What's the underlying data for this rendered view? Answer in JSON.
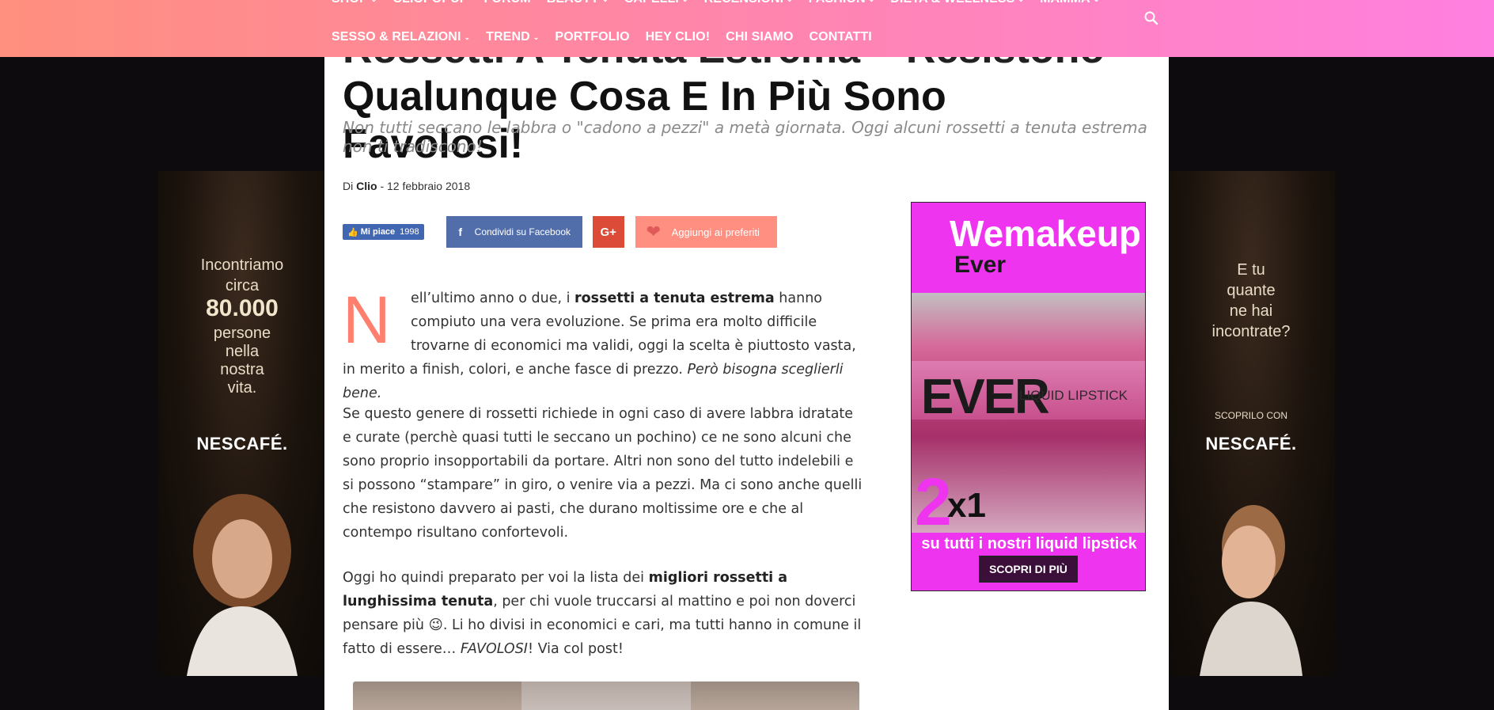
{
  "nav": {
    "row1": [
      {
        "label": "SHOP",
        "dropdown": true
      },
      {
        "label": "CLIOPOPUP",
        "dropdown": false
      },
      {
        "label": "FORUM",
        "dropdown": false
      },
      {
        "label": "BEAUTY",
        "dropdown": true
      },
      {
        "label": "CAPELLI",
        "dropdown": true
      },
      {
        "label": "RECENSIONI",
        "dropdown": true
      },
      {
        "label": "FASHION",
        "dropdown": true
      },
      {
        "label": "DIETA & WELLNESS",
        "dropdown": true
      },
      {
        "label": "MAMMA",
        "dropdown": true
      }
    ],
    "row2": [
      {
        "label": "SESSO & RELAZIONI",
        "dropdown": true
      },
      {
        "label": "TREND",
        "dropdown": true
      },
      {
        "label": "PORTFOLIO",
        "dropdown": false
      },
      {
        "label": "HEY CLIO!",
        "dropdown": false
      },
      {
        "label": "CHI SIAMO",
        "dropdown": false
      },
      {
        "label": "CONTATTI",
        "dropdown": false
      }
    ],
    "chevron": "⌄"
  },
  "article": {
    "title_line1": "Rossetti A Tenuta Estrema – Resistono A",
    "title_line2": "Qualunque Cosa E In Più Sono Favolosi!",
    "subtitle": "Non tutti seccano le labbra o \"cadono a pezzi\" a metà giornata. Oggi alcuni rossetti a tenuta estrema non ti tradiscono!",
    "by_prefix": "Di",
    "author": "Clio",
    "date": "- 12 febbraio 2018",
    "dropcap": "N",
    "p1_a": "ell’ultimo anno o due, i ",
    "p1_b": "rossetti a tenuta estrema",
    "p1_c": " hanno compiuto una vera evoluzione. Se prima era molto difficile trovarne di economici ma validi, oggi la scelta è piuttosto vasta, in merito a finish, colori, e anche fasce di prezzo. ",
    "p1_d": "Però bisogna sceglierli bene.",
    "p2": "Se questo genere di rossetti richiede in ogni caso di avere labbra idratate e curate (perchè quasi tutti le seccano un pochino) ce ne sono alcuni che sono proprio insopportabili da portare. Altri non sono del tutto indelebili e si possono “stampare” in giro, o venire via a pezzi. Ma ci sono anche quelli che resistono davvero ai pasti, che durano moltissime ore e che al contempo risultano confortevoli.",
    "p3_a": "Oggi ho quindi preparato per voi la lista dei ",
    "p3_b": "migliori rossetti a lunghissima tenuta",
    "p3_c": ", per chi vuole truccarsi al mattino e poi non doverci pensare più 😉. Li ho divisi in economici e cari, ma tutti hanno in comune il fatto di essere… ",
    "p3_d": "FAVOLOSI",
    "p3_e": "! Via col post!"
  },
  "share": {
    "like_label": "Mi piace",
    "like_count": "1998",
    "facebook": "Condividi su Facebook",
    "gplus": "G+",
    "favorites": "Aggiungi ai preferiti"
  },
  "ads": {
    "left": {
      "line1": "Incontriamo",
      "line2": "circa",
      "big": "80.000",
      "line3": "persone",
      "line4": "nella",
      "line5": "nostra",
      "line6": "vita.",
      "brand": "NESCAFÉ."
    },
    "right": {
      "line1": "E tu",
      "line2": "quante",
      "line3": "ne hai",
      "line4": "incontrate?",
      "cta": "SCOPRILO CON",
      "brand": "NESCAFÉ."
    },
    "sidebar": {
      "title": "Wemakeup",
      "subtitle": "Ever",
      "ever": "EVER",
      "liquid": "LIQUID LIPSTICK",
      "big2": "2",
      "x1": "x1",
      "promo": "su tutti i nostri liquid lipstick",
      "button": "SCOPRI DI PIÙ",
      "bg_color": "#ee34ee"
    }
  },
  "colors": {
    "accent": "#ff7f6e",
    "facebook": "#516eab",
    "gplus": "#dc4a38",
    "fav": "#ff8f80"
  }
}
